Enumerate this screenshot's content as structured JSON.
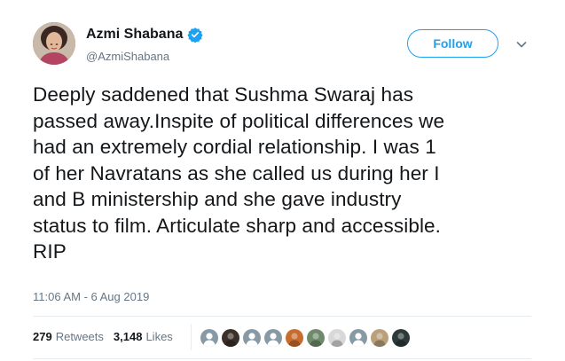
{
  "author": {
    "name": "Azmi Shabana",
    "handle": "@AzmiShabana",
    "verified": true,
    "avatar_icon": "profile-photo"
  },
  "follow_label": "Follow",
  "tweet_lines": [
    "Deeply saddened that Sushma Swaraj has",
    "passed away.Inspite of political differences we",
    "had an extremely cordial relationship. I was 1",
    "of her Navratans as she called us during her I",
    "and B ministership and she gave industry",
    "status to film. Articulate sharp and accessible.",
    "RIP"
  ],
  "timestamp": "11:06 AM - 6 Aug 2019",
  "stats": {
    "retweets_count": "279",
    "retweets_label": "Retweets",
    "likes_count": "3,148",
    "likes_label": "Likes"
  },
  "likers": [
    {
      "icon": "default-avatar",
      "color": "#8899a6"
    },
    {
      "icon": "user-avatar",
      "color": "#3b2f2a"
    },
    {
      "icon": "default-avatar",
      "color": "#8899a6"
    },
    {
      "icon": "default-avatar",
      "color": "#8899a6"
    },
    {
      "icon": "user-avatar",
      "color": "#c86b2e"
    },
    {
      "icon": "user-avatar",
      "color": "#6e8a6a"
    },
    {
      "icon": "user-avatar",
      "color": "#d8d8d8"
    },
    {
      "icon": "default-avatar",
      "color": "#8899a6"
    },
    {
      "icon": "user-avatar",
      "color": "#b9a07a"
    },
    {
      "icon": "user-avatar",
      "color": "#2d3a3a"
    }
  ],
  "colors": {
    "accent": "#1da1f2",
    "text": "#14171a",
    "muted": "#657786",
    "divider": "#e6ecf0"
  }
}
